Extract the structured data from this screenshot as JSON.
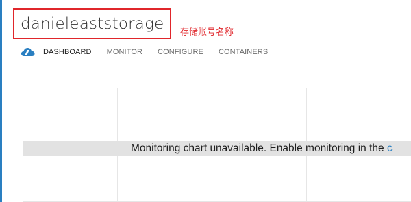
{
  "header": {
    "account_name": "danieleaststorage",
    "annotation": "存储账号名称",
    "highlight_color": "#e0262b"
  },
  "tabs": [
    {
      "label": "DASHBOARD",
      "active": true
    },
    {
      "label": "MONITOR",
      "active": false
    },
    {
      "label": "CONFIGURE",
      "active": false
    },
    {
      "label": "CONTAINERS",
      "active": false
    }
  ],
  "tab_icon": "storage-cloud-icon",
  "chart": {
    "message": "Monitoring chart unavailable. Enable monitoring in the ",
    "link_text": "c",
    "link_color": "#2a7fc1"
  },
  "colors": {
    "accent": "#2a7fc1",
    "banner_bg": "#e2e2e2"
  }
}
